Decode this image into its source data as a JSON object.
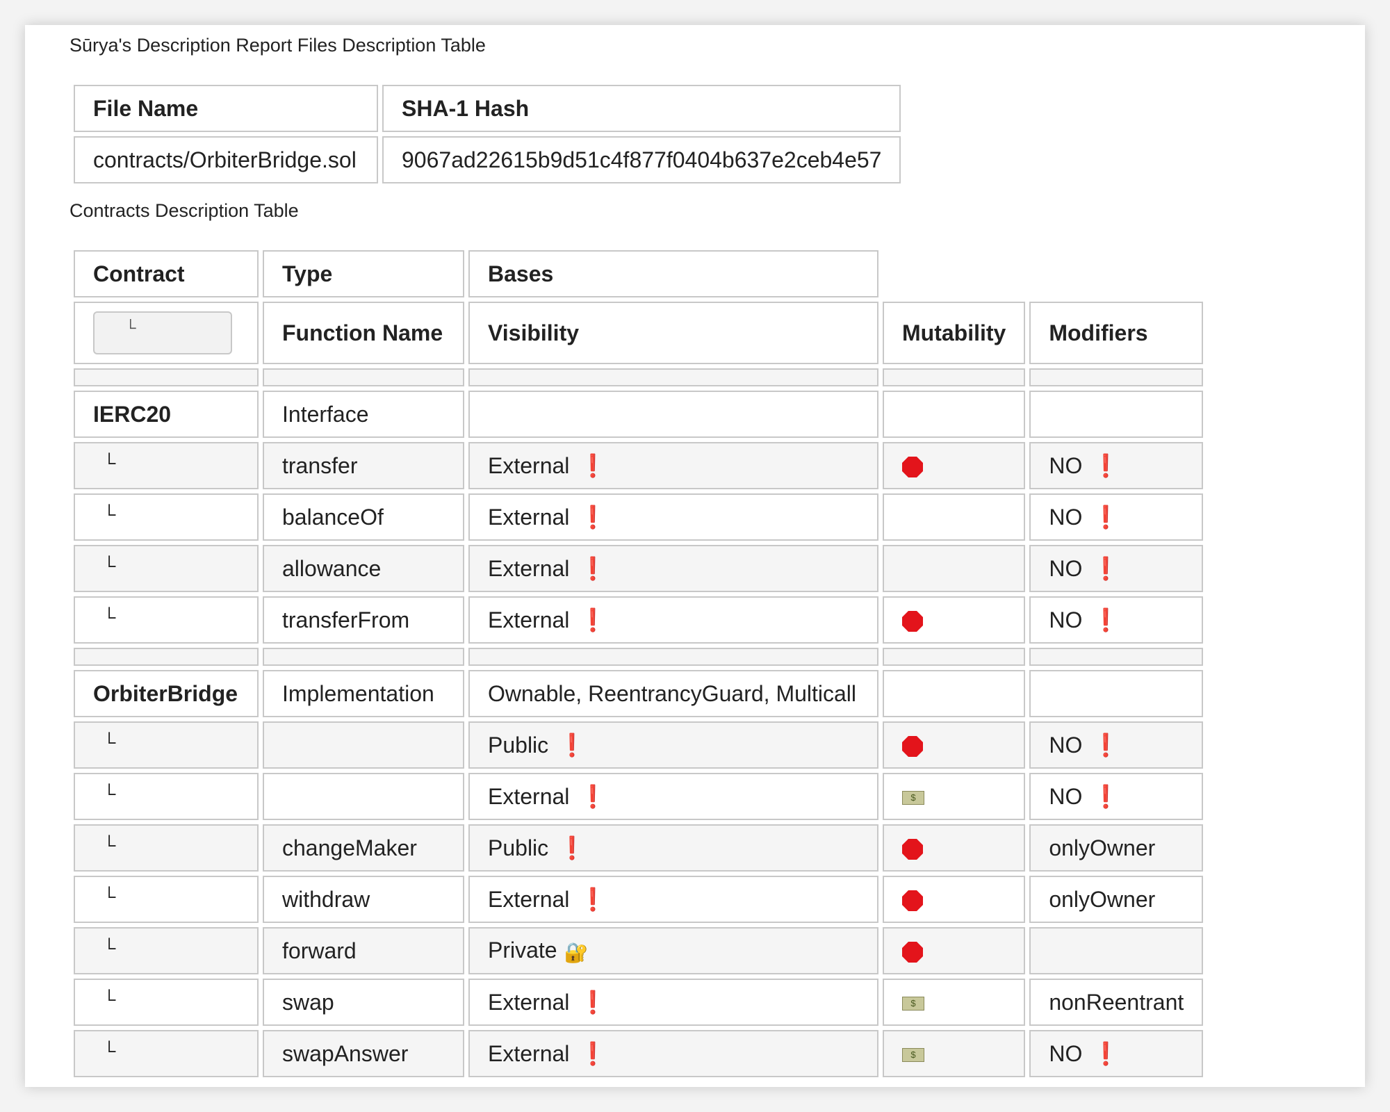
{
  "files_title": "Sūrya's Description Report Files Description Table",
  "files_table": {
    "headers": [
      "File Name",
      "SHA-1 Hash"
    ],
    "rows": [
      [
        "contracts/OrbiterBridge.sol",
        "9067ad22615b9d51c4f877f0404b637e2ceb4e57"
      ]
    ]
  },
  "contracts_title": "Contracts Description Table",
  "contracts_table": {
    "headers": [
      "Contract",
      "Type",
      "Bases"
    ],
    "subheaders": [
      "└",
      "Function Name",
      "Visibility",
      "Mutability",
      "Modifiers"
    ],
    "arrow": "└",
    "exclaim": "❗",
    "money_glyph": "$",
    "lock_glyph": "🔐",
    "ierc20": {
      "name": "IERC20",
      "type": "Interface",
      "bases": "",
      "functions": [
        {
          "name": "transfer",
          "visibility": "External",
          "excl": true,
          "mutability": "stop",
          "modifiers": "NO"
        },
        {
          "name": "balanceOf",
          "visibility": "External",
          "excl": true,
          "mutability": "",
          "modifiers": "NO"
        },
        {
          "name": "allowance",
          "visibility": "External",
          "excl": true,
          "mutability": "",
          "modifiers": "NO"
        },
        {
          "name": "transferFrom",
          "visibility": "External",
          "excl": true,
          "mutability": "stop",
          "modifiers": "NO"
        }
      ]
    },
    "orbiter": {
      "name": "OrbiterBridge",
      "type": "Implementation",
      "bases": "Ownable, ReentrancyGuard, Multicall",
      "functions": [
        {
          "name": "",
          "visibility": "Public",
          "excl": true,
          "mutability": "stop",
          "modifiers": "NO"
        },
        {
          "name": "",
          "visibility": "External",
          "excl": true,
          "mutability": "money",
          "modifiers": "NO"
        },
        {
          "name": "changeMaker",
          "visibility": "Public",
          "excl": true,
          "mutability": "stop",
          "modifiers": "onlyOwner"
        },
        {
          "name": "withdraw",
          "visibility": "External",
          "excl": true,
          "mutability": "stop",
          "modifiers": "onlyOwner"
        },
        {
          "name": "forward",
          "visibility": "Private",
          "excl": false,
          "lock": true,
          "mutability": "stop",
          "modifiers": ""
        },
        {
          "name": "swap",
          "visibility": "External",
          "excl": true,
          "mutability": "money",
          "modifiers": "nonReentrant"
        },
        {
          "name": "swapAnswer",
          "visibility": "External",
          "excl": true,
          "mutability": "money",
          "modifiers": "NO"
        }
      ]
    }
  },
  "colors": {
    "exclaim": "#d0021b",
    "stop": "#e3141b",
    "row_alt": "#f5f5f5",
    "border": "#c8c8c8"
  }
}
